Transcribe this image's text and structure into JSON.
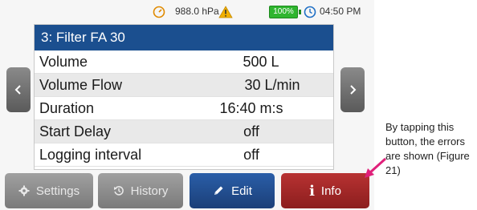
{
  "status_bar": {
    "pressure": "988.0 hPa",
    "battery_percent": "100%",
    "time": "04:50 PM",
    "colors": {
      "warning": "#f2b000",
      "battery": "#2fb52f",
      "clock": "#1f6fc5",
      "gauge": "#e08a00"
    },
    "icons": [
      "gauge-icon",
      "warning-icon",
      "battery-icon",
      "clock-icon"
    ]
  },
  "screen": {
    "title": "3: Filter FA 30",
    "rows": [
      {
        "label": "Volume",
        "value": "500 L"
      },
      {
        "label": "Volume Flow",
        "value": "30 L/min"
      },
      {
        "label": "Duration",
        "value": "16:40 m:s"
      },
      {
        "label": "Start Delay",
        "value": "off"
      },
      {
        "label": "Logging interval",
        "value": "off"
      }
    ]
  },
  "nav": {
    "left": "<",
    "right": ">"
  },
  "buttons": {
    "settings": "Settings",
    "history": "History",
    "edit": "Edit",
    "info": "Info"
  },
  "annotation": {
    "text": "By tapping this button, the errors are shown (Figure 21)",
    "arrow_color": "#e0207a"
  }
}
